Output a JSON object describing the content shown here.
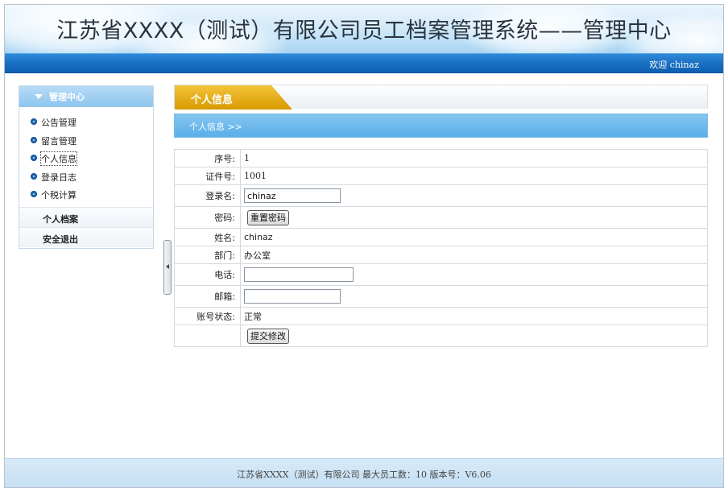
{
  "header": {
    "title": "江苏省XXXX（测试）有限公司员工档案管理系统——管理中心",
    "welcome": "欢迎 chinaz"
  },
  "sidebar": {
    "title": "管理中心",
    "items": [
      {
        "label": "公告管理"
      },
      {
        "label": "留言管理"
      },
      {
        "label": "个人信息",
        "active": true
      },
      {
        "label": "登录日志"
      },
      {
        "label": "个税计算"
      }
    ],
    "sections": [
      {
        "label": "个人档案"
      },
      {
        "label": "安全退出"
      }
    ]
  },
  "main": {
    "tab_label": "个人信息",
    "subtitle": "个人信息 >>",
    "fields": {
      "seq": {
        "label": "序号:",
        "value": "1"
      },
      "cert": {
        "label": "证件号:",
        "value": "1001"
      },
      "login": {
        "label": "登录名:",
        "value": "chinaz"
      },
      "password": {
        "label": "密码:",
        "button": "重置密码"
      },
      "name": {
        "label": "姓名:",
        "value": "chinaz"
      },
      "dept": {
        "label": "部门:",
        "value": "办公室"
      },
      "phone": {
        "label": "电话:",
        "value": ""
      },
      "email": {
        "label": "邮箱:",
        "value": ""
      },
      "status": {
        "label": "账号状态:",
        "value": "正常"
      }
    },
    "submit_label": "提交修改"
  },
  "footer": {
    "text": "江苏省XXXX（测试）有限公司  最大员工数：10 版本号：V6.06"
  },
  "colors": {
    "accent_blue": "#1a6fc3",
    "tab_gold": "#e0a400",
    "sub_bar_blue": "#5aafe8"
  }
}
